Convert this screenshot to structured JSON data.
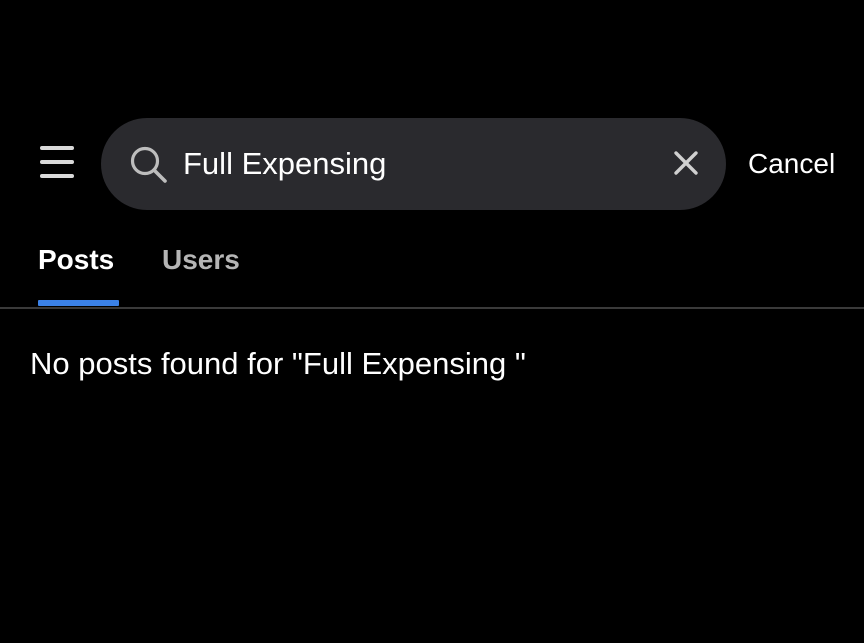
{
  "header": {
    "menu_icon": "hamburger-menu-icon",
    "search": {
      "icon": "search-icon",
      "value": "Full Expensing",
      "clear_icon": "close-icon"
    },
    "cancel_label": "Cancel"
  },
  "tabs": [
    {
      "label": "Posts",
      "selected": true
    },
    {
      "label": "Users",
      "selected": false
    }
  ],
  "results": {
    "empty_message": "No posts found for \"Full Expensing \""
  },
  "colors": {
    "background": "#000000",
    "search_field": "#2a2a2e",
    "tab_indicator": "#3b82e8",
    "inactive_tab": "#b5b5b5",
    "divider": "#3a3a3a"
  }
}
